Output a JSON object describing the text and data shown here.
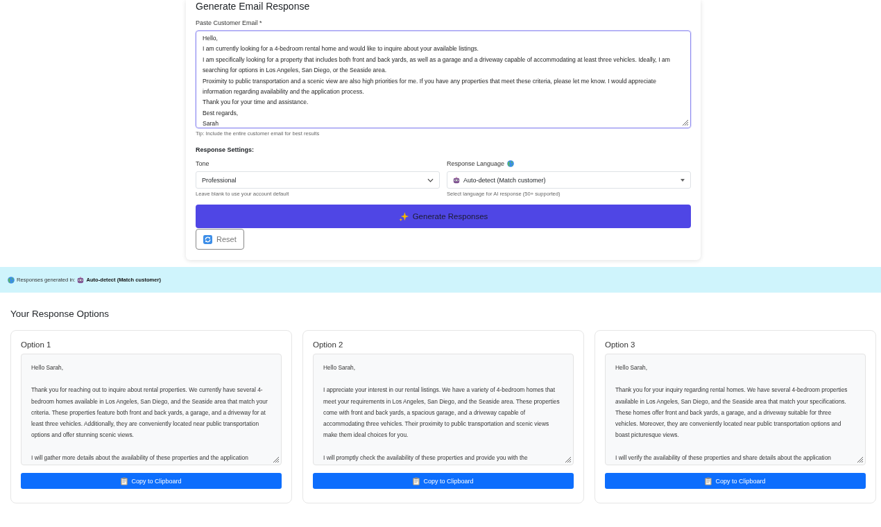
{
  "form": {
    "title": "Generate Email Response",
    "email_label": "Paste Customer Email *",
    "email_lines": [
      "Hello,",
      "I am currently looking for a 4-bedroom rental home and would like to inquire about your available listings.",
      "I am specifically looking for a property that includes both front and back yards, as well as a garage and a driveway capable of accommodating at least three vehicles. Ideally, I am searching for options in Los Angeles, San Diego, or the Seaside area.",
      "Proximity to public transportation and a scenic view are also high priorities for me. If you have any properties that meet these criteria, please let me know. I would appreciate information regarding availability and the application process.",
      "Thank you for your time and assistance.",
      "Best regards,",
      "Sarah"
    ],
    "tip": "Tip: Include the entire customer email for best results",
    "settings_heading": "Response Settings:",
    "tone": {
      "label": "Tone",
      "value": "Professional",
      "help": "Leave blank to use your account default"
    },
    "language": {
      "label": "Response Language",
      "value": "Auto-detect (Match customer)",
      "help": "Select language for AI response (50+ supported)"
    },
    "generate_button": "Generate Responses",
    "reset_button": "Reset"
  },
  "banner": {
    "prefix": "Responses generated in:",
    "language": "Auto-detect (Match customer)"
  },
  "results": {
    "heading": "Your Response Options",
    "options": [
      {
        "title": "Option 1",
        "paragraphs": [
          "Hello Sarah,",
          "Thank you for reaching out to inquire about rental properties. We currently have several 4-bedroom homes available in Los Angeles, San Diego, and the Seaside area that match your criteria. These properties feature both front and back yards, a garage, and a driveway for at least three vehicles. Additionally, they are conveniently located near public transportation options and offer stunning scenic views.",
          "I will gather more details about the availability of these properties and the application"
        ],
        "copy_button": "Copy to Clipboard"
      },
      {
        "title": "Option 2",
        "paragraphs": [
          "Hello Sarah,",
          "I appreciate your interest in our rental listings. We have a variety of 4-bedroom homes that meet your requirements in Los Angeles, San Diego, and the Seaside area. These properties come with front and back yards, a spacious garage, and a driveway capable of accommodating three vehicles. Their proximity to public transportation and scenic views make them ideal choices for you.",
          "I will promptly check the availability of these properties and provide you with the"
        ],
        "copy_button": "Copy to Clipboard"
      },
      {
        "title": "Option 3",
        "paragraphs": [
          "Hello Sarah,",
          "Thank you for your inquiry regarding rental homes. We have several 4-bedroom properties available in Los Angeles, San Diego, and the Seaside area that match your specifications. These homes offer front and back yards, a garage, and a driveway suitable for three vehicles. Moreover, they are conveniently located near public transportation options and boast picturesque views.",
          "I will verify the availability of these properties and share details about the application"
        ],
        "copy_button": "Copy to Clipboard"
      }
    ]
  }
}
